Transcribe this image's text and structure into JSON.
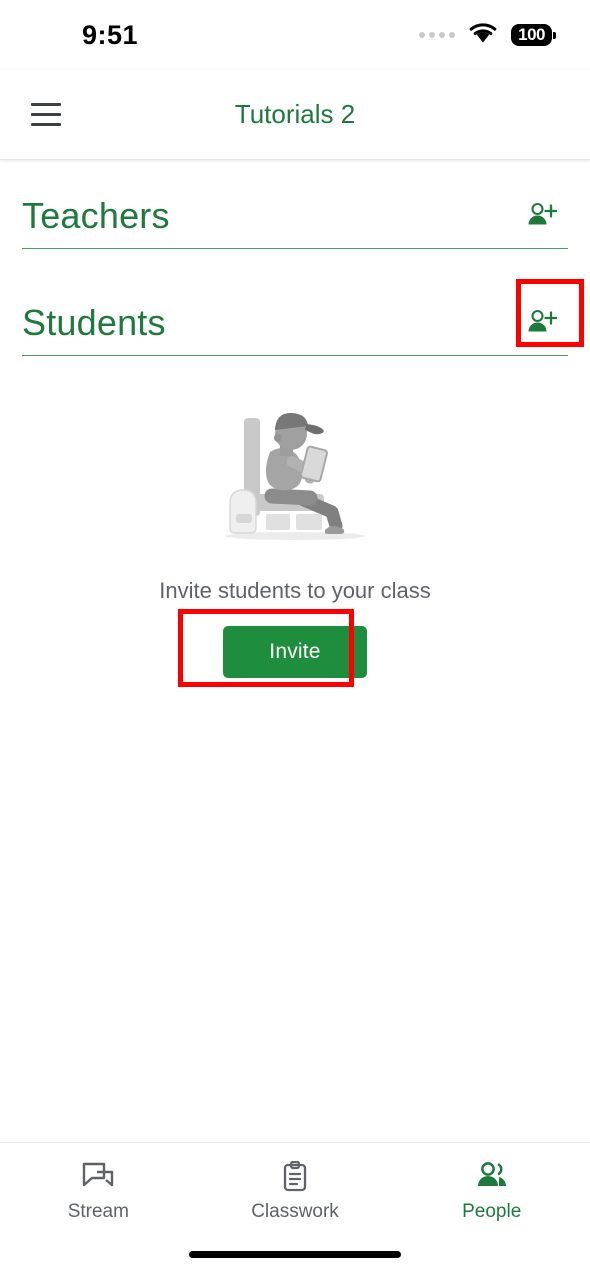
{
  "status_bar": {
    "time": "9:51",
    "battery_percent": "100",
    "icons": [
      "signal-dots-icon",
      "wifi-icon",
      "battery-icon"
    ]
  },
  "app_bar": {
    "menu_icon": "hamburger-menu-icon",
    "title": "Tutorials 2"
  },
  "sections": [
    {
      "id": "teachers",
      "title": "Teachers",
      "add_icon": "person-add-icon",
      "highlighted": false
    },
    {
      "id": "students",
      "title": "Students",
      "add_icon": "person-add-icon",
      "highlighted": true
    }
  ],
  "empty_state": {
    "illustration": "student-reading-tablet-illustration",
    "message": "Invite students to your class",
    "button_label": "Invite",
    "button_highlighted": true
  },
  "bottom_nav": {
    "items": [
      {
        "label": "Stream",
        "icon": "chat-bubbles-icon",
        "active": false
      },
      {
        "label": "Classwork",
        "icon": "clipboard-icon",
        "active": false
      },
      {
        "label": "People",
        "icon": "people-icon",
        "active": true
      }
    ]
  },
  "colors": {
    "brand_green": "#1e7a3c",
    "button_green": "#1e8e3e",
    "highlight_red": "#ff0000",
    "muted_text": "#5f6368",
    "divider_green": "#4f9c6b"
  }
}
